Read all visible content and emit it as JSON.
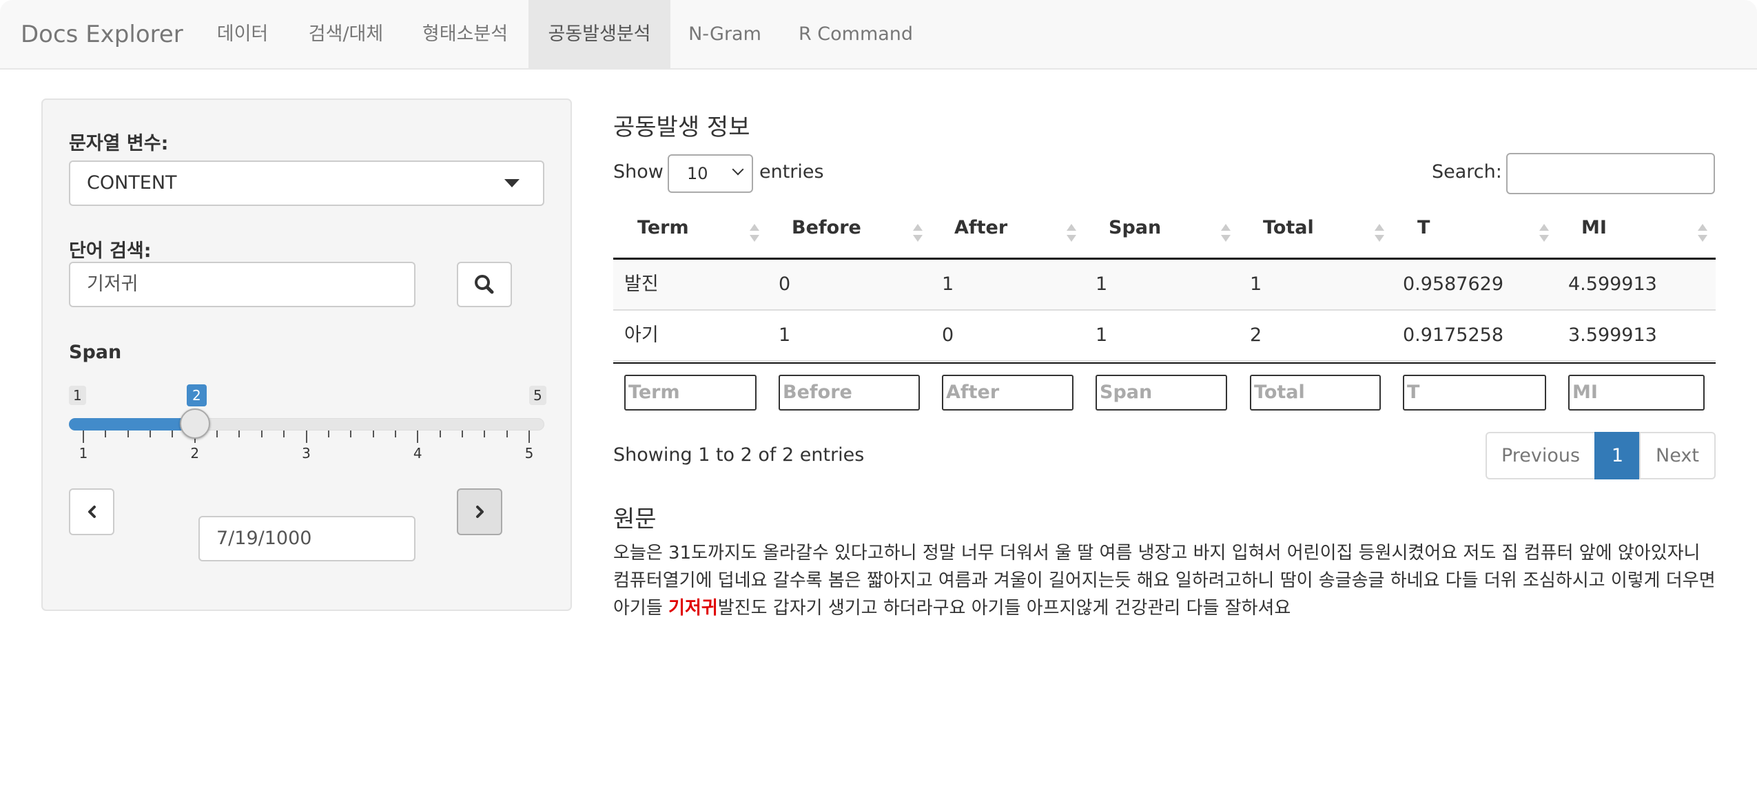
{
  "navbar": {
    "brand": "Docs Explorer",
    "tabs": [
      {
        "label": "데이터",
        "active": false
      },
      {
        "label": "검색/대체",
        "active": false
      },
      {
        "label": "형태소분석",
        "active": false
      },
      {
        "label": "공동발생분석",
        "active": true
      },
      {
        "label": "N-Gram",
        "active": false
      },
      {
        "label": "R Command",
        "active": false
      }
    ]
  },
  "sidebar": {
    "variable_label": "문자열 변수:",
    "variable_value": "CONTENT",
    "word_label": "단어 검색:",
    "word_value": "기저귀",
    "span_label": "Span",
    "slider": {
      "min": "1",
      "max": "5",
      "value": "2",
      "tick_labels": [
        "1",
        "2",
        "3",
        "4",
        "5"
      ]
    },
    "date_value": "7/19/1000",
    "icons": {
      "search": "search-icon",
      "prev": "chevron-left-icon",
      "next": "chevron-right-icon",
      "select": "caret-down-icon"
    }
  },
  "main": {
    "title": "공동발생 정보",
    "show_label": "Show",
    "length_value": "10",
    "entries_label": "entries",
    "search_label": "Search:",
    "columns": [
      "Term",
      "Before",
      "After",
      "Span",
      "Total",
      "T",
      "MI"
    ],
    "rows": [
      [
        "발진",
        "0",
        "1",
        "1",
        "1",
        "0.9587629",
        "4.599913"
      ],
      [
        "아기",
        "1",
        "0",
        "1",
        "2",
        "0.9175258",
        "3.599913"
      ]
    ],
    "filters": [
      "Term",
      "Before",
      "After",
      "Span",
      "Total",
      "T",
      "MI"
    ],
    "info": "Showing 1 to 2 of 2 entries",
    "pagination": {
      "previous": "Previous",
      "current": "1",
      "next": "Next"
    },
    "source_title": "원문",
    "source_before": "오늘은 31도까지도 올라갈수 있다고하니 정말 너무 더워서 울 딸 여름 냉장고 바지 입혀서 어린이집 등원시켰어요 저도 집 컴퓨터 앞에 앉아있자니 컴퓨터열기에 덥네요 갈수록 봄은 짧아지고 여름과 겨울이 길어지는듯 해요 일하려고하니 땀이 송글송글 하네요 다들 더위 조심하시고 이렇게 더우면 아기들 ",
    "source_highlight": "기저귀",
    "source_after": "발진도 갑자기 생기고 하더라구요 아기들 아프지않게 건강관리 다들 잘하셔요",
    "colors": {
      "accent": "#428bca",
      "highlight": "#e00000",
      "active_page": "#337ab7"
    }
  }
}
